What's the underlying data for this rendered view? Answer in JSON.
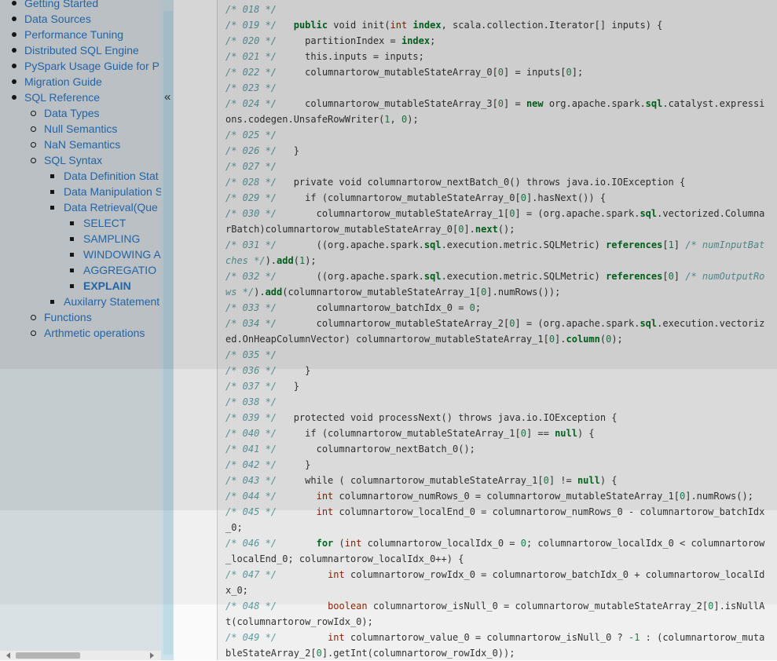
{
  "sidebar": {
    "items": [
      {
        "label": "Getting Started",
        "level": 1
      },
      {
        "label": "Data Sources",
        "level": 1
      },
      {
        "label": "Performance Tuning",
        "level": 1
      },
      {
        "label": "Distributed SQL Engine",
        "level": 1
      },
      {
        "label": "PySpark Usage Guide for P",
        "level": 1
      },
      {
        "label": "Migration Guide",
        "level": 1
      },
      {
        "label": "SQL Reference",
        "level": 1
      },
      {
        "label": "Data Types",
        "level": 2
      },
      {
        "label": "Null Semantics",
        "level": 2
      },
      {
        "label": "NaN Semantics",
        "level": 2
      },
      {
        "label": "SQL Syntax",
        "level": 2
      },
      {
        "label": "Data Definition Stat",
        "level": 3
      },
      {
        "label": "Data Manipulation S",
        "level": 3
      },
      {
        "label": "Data Retrieval(Que",
        "level": 3
      },
      {
        "label": "SELECT",
        "level": 4
      },
      {
        "label": "SAMPLING",
        "level": 4
      },
      {
        "label": "WINDOWING A",
        "level": 4
      },
      {
        "label": "AGGREGATIO",
        "level": 4
      },
      {
        "label": "EXPLAIN",
        "level": 4,
        "active": true
      },
      {
        "label": "Auxilarry Statement",
        "level": 3
      },
      {
        "label": "Functions",
        "level": 2
      },
      {
        "label": "Arthmetic operations",
        "level": 2
      }
    ],
    "collapse_glyph": "«"
  },
  "code": {
    "lines": [
      [
        [
          "cm",
          "/* 018 */"
        ]
      ],
      [
        [
          "cm",
          "/* 019 */"
        ],
        [
          "t",
          "   "
        ],
        [
          "kw",
          "public"
        ],
        [
          "t",
          " void init("
        ],
        [
          "kt",
          "int"
        ],
        [
          "t",
          " "
        ],
        [
          "nb",
          "index"
        ],
        [
          "t",
          ", scala.collection.Iterator[] inputs) {"
        ]
      ],
      [
        [
          "cm",
          "/* 020 */"
        ],
        [
          "t",
          "     partitionIndex = "
        ],
        [
          "nb",
          "index"
        ],
        [
          "t",
          ";"
        ]
      ],
      [
        [
          "cm",
          "/* 021 */"
        ],
        [
          "t",
          "     this.inputs = inputs;"
        ]
      ],
      [
        [
          "cm",
          "/* 022 */"
        ],
        [
          "t",
          "     columnartorow_mutableStateArray_0["
        ],
        [
          "num",
          "0"
        ],
        [
          "t",
          "] = inputs["
        ],
        [
          "num",
          "0"
        ],
        [
          "t",
          "];"
        ]
      ],
      [
        [
          "cm",
          "/* 023 */"
        ]
      ],
      [
        [
          "cm",
          "/* 024 */"
        ],
        [
          "t",
          "     columnartorow_mutableStateArray_3["
        ],
        [
          "num",
          "0"
        ],
        [
          "t",
          "] = "
        ],
        [
          "kw",
          "new"
        ],
        [
          "t",
          " org.apache.spark."
        ],
        [
          "nb",
          "sql"
        ],
        [
          "t",
          ".catalyst.expressions.codegen.UnsafeRowWriter("
        ],
        [
          "num",
          "1"
        ],
        [
          "t",
          ", "
        ],
        [
          "num",
          "0"
        ],
        [
          "t",
          ");"
        ]
      ],
      [
        [
          "cm",
          "/* 025 */"
        ]
      ],
      [
        [
          "cm",
          "/* 026 */"
        ],
        [
          "t",
          "   }"
        ]
      ],
      [
        [
          "cm",
          "/* 027 */"
        ]
      ],
      [
        [
          "cm",
          "/* 028 */"
        ],
        [
          "t",
          "   private void columnartorow_nextBatch_0() throws java.io.IOException {"
        ]
      ],
      [
        [
          "cm",
          "/* 029 */"
        ],
        [
          "t",
          "     if (columnartorow_mutableStateArray_0["
        ],
        [
          "num",
          "0"
        ],
        [
          "t",
          "].hasNext()) {"
        ]
      ],
      [
        [
          "cm",
          "/* 030 */"
        ],
        [
          "t",
          "       columnartorow_mutableStateArray_1["
        ],
        [
          "num",
          "0"
        ],
        [
          "t",
          "] = (org.apache.spark."
        ],
        [
          "nb",
          "sql"
        ],
        [
          "t",
          ".vectorized.ColumnarBatch)columnartorow_mutableStateArray_0["
        ],
        [
          "num",
          "0"
        ],
        [
          "t",
          "]."
        ],
        [
          "nb",
          "next"
        ],
        [
          "t",
          "();"
        ]
      ],
      [
        [
          "cm",
          "/* 031 */"
        ],
        [
          "t",
          "       ((org.apache.spark."
        ],
        [
          "nb",
          "sql"
        ],
        [
          "t",
          ".execution.metric.SQLMetric) "
        ],
        [
          "nb",
          "references"
        ],
        [
          "t",
          "["
        ],
        [
          "num",
          "1"
        ],
        [
          "t",
          "] "
        ],
        [
          "cm",
          "/* numInputBatches */"
        ],
        [
          "t",
          ")."
        ],
        [
          "nb",
          "add"
        ],
        [
          "t",
          "("
        ],
        [
          "num",
          "1"
        ],
        [
          "t",
          ");"
        ]
      ],
      [
        [
          "cm",
          "/* 032 */"
        ],
        [
          "t",
          "       ((org.apache.spark."
        ],
        [
          "nb",
          "sql"
        ],
        [
          "t",
          ".execution.metric.SQLMetric) "
        ],
        [
          "nb",
          "references"
        ],
        [
          "t",
          "["
        ],
        [
          "num",
          "0"
        ],
        [
          "t",
          "] "
        ],
        [
          "cm",
          "/* numOutputRows */"
        ],
        [
          "t",
          ")."
        ],
        [
          "nb",
          "add"
        ],
        [
          "t",
          "(columnartorow_mutableStateArray_1["
        ],
        [
          "num",
          "0"
        ],
        [
          "t",
          "].numRows());"
        ]
      ],
      [
        [
          "cm",
          "/* 033 */"
        ],
        [
          "t",
          "       columnartorow_batchIdx_0 = "
        ],
        [
          "num",
          "0"
        ],
        [
          "t",
          ";"
        ]
      ],
      [
        [
          "cm",
          "/* 034 */"
        ],
        [
          "t",
          "       columnartorow_mutableStateArray_2["
        ],
        [
          "num",
          "0"
        ],
        [
          "t",
          "] = (org.apache.spark."
        ],
        [
          "nb",
          "sql"
        ],
        [
          "t",
          ".execution.vectorized.OnHeapColumnVector) columnartorow_mutableStateArray_1["
        ],
        [
          "num",
          "0"
        ],
        [
          "t",
          "]."
        ],
        [
          "nb",
          "column"
        ],
        [
          "t",
          "("
        ],
        [
          "num",
          "0"
        ],
        [
          "t",
          ");"
        ]
      ],
      [
        [
          "cm",
          "/* 035 */"
        ]
      ],
      [
        [
          "cm",
          "/* 036 */"
        ],
        [
          "t",
          "     }"
        ]
      ],
      [
        [
          "cm",
          "/* 037 */"
        ],
        [
          "t",
          "   }"
        ]
      ],
      [
        [
          "cm",
          "/* 038 */"
        ]
      ],
      [
        [
          "cm",
          "/* 039 */"
        ],
        [
          "t",
          "   protected void processNext() throws java.io.IOException {"
        ]
      ],
      [
        [
          "cm",
          "/* 040 */"
        ],
        [
          "t",
          "     if (columnartorow_mutableStateArray_1["
        ],
        [
          "num",
          "0"
        ],
        [
          "t",
          "] == "
        ],
        [
          "kw",
          "null"
        ],
        [
          "t",
          ") {"
        ]
      ],
      [
        [
          "cm",
          "/* 041 */"
        ],
        [
          "t",
          "       columnartorow_nextBatch_0();"
        ]
      ],
      [
        [
          "cm",
          "/* 042 */"
        ],
        [
          "t",
          "     }"
        ]
      ],
      [
        [
          "cm",
          "/* 043 */"
        ],
        [
          "t",
          "     while ( columnartorow_mutableStateArray_1["
        ],
        [
          "num",
          "0"
        ],
        [
          "t",
          "] != "
        ],
        [
          "kw",
          "null"
        ],
        [
          "t",
          ") {"
        ]
      ],
      [
        [
          "cm",
          "/* 044 */"
        ],
        [
          "t",
          "       "
        ],
        [
          "kt",
          "int"
        ],
        [
          "t",
          " columnartorow_numRows_0 = columnartorow_mutableStateArray_1["
        ],
        [
          "num",
          "0"
        ],
        [
          "t",
          "].numRows();"
        ]
      ],
      [
        [
          "cm",
          "/* 045 */"
        ],
        [
          "t",
          "       "
        ],
        [
          "kt",
          "int"
        ],
        [
          "t",
          " columnartorow_localEnd_0 = columnartorow_numRows_0 - columnartorow_batchIdx_0;"
        ]
      ],
      [
        [
          "cm",
          "/* 046 */"
        ],
        [
          "t",
          "       "
        ],
        [
          "kw",
          "for"
        ],
        [
          "t",
          " ("
        ],
        [
          "kt",
          "int"
        ],
        [
          "t",
          " columnartorow_localIdx_0 = "
        ],
        [
          "num",
          "0"
        ],
        [
          "t",
          "; columnartorow_localIdx_0 < columnartorow_localEnd_0; columnartorow_localIdx_0++) {"
        ]
      ],
      [
        [
          "cm",
          "/* 047 */"
        ],
        [
          "t",
          "         "
        ],
        [
          "kt",
          "int"
        ],
        [
          "t",
          " columnartorow_rowIdx_0 = columnartorow_batchIdx_0 + columnartorow_localIdx_0;"
        ]
      ],
      [
        [
          "cm",
          "/* 048 */"
        ],
        [
          "t",
          "         "
        ],
        [
          "kt",
          "boolean"
        ],
        [
          "t",
          " columnartorow_isNull_0 = columnartorow_mutableStateArray_2["
        ],
        [
          "num",
          "0"
        ],
        [
          "t",
          "].isNullAt(columnartorow_rowIdx_0);"
        ]
      ],
      [
        [
          "cm",
          "/* 049 */"
        ],
        [
          "t",
          "         "
        ],
        [
          "kt",
          "int"
        ],
        [
          "t",
          " columnartorow_value_0 = columnartorow_isNull_0 ? "
        ],
        [
          "num",
          "-1"
        ],
        [
          "t",
          " : (columnartorow_mutableStateArray_2["
        ],
        [
          "num",
          "0"
        ],
        [
          "t",
          "].getInt(columnartorow_rowIdx_0));"
        ]
      ]
    ]
  }
}
